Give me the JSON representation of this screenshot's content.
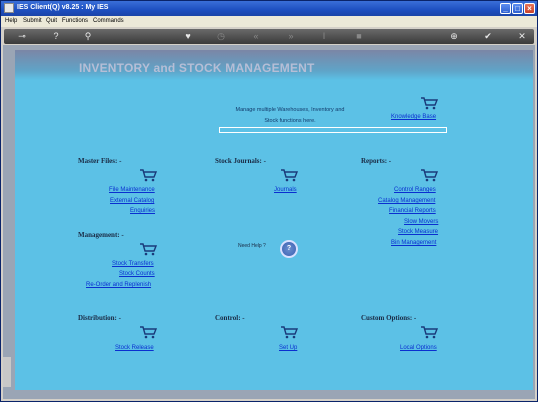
{
  "window": {
    "title": "IES Client(Q) v8.25 : My IES"
  },
  "menu": [
    "Help",
    "Submit",
    "Quit",
    "Functions",
    "Commands"
  ],
  "toolbar_icons": [
    "key-icon",
    "help-icon",
    "search-icon",
    "heart-icon",
    "clock-icon",
    "rewind-icon",
    "fast-forward-icon",
    "text-cursor-icon",
    "stop-icon",
    "add-icon",
    "check-icon",
    "close-icon"
  ],
  "page": {
    "title": "INVENTORY and STOCK MANAGEMENT",
    "intro_line1": "Manage multiple Warehouses, Inventory and",
    "intro_line2": "Stock functions here.",
    "knowledge_base": "Knowledge Base",
    "need_help": "Need Help ?",
    "help_symbol": "?"
  },
  "sections": {
    "master_files": {
      "title": "Master Files: -",
      "links": [
        "File Maintenance",
        "External Catalog",
        "Enquiries"
      ]
    },
    "stock_journals": {
      "title": "Stock Journals: -",
      "links": [
        "Journals"
      ]
    },
    "reports": {
      "title": "Reports: -",
      "links": [
        "Control Ranges",
        "Catalog Management",
        "Financial Reports",
        "Slow Movers",
        "Stock Measure",
        "Bin Management"
      ]
    },
    "management": {
      "title": "Management: -",
      "links": [
        "Stock Transfers",
        "Stock Counts",
        "Re-Order and Replenish"
      ]
    },
    "distribution": {
      "title": "Distribution: -",
      "links": [
        "Stock Release"
      ]
    },
    "control": {
      "title": "Control: -",
      "links": [
        "Set Up"
      ]
    },
    "custom_options": {
      "title": "Custom Options: -",
      "links": [
        "Local Options"
      ]
    }
  },
  "colors": {
    "panel": "#5cc1e6",
    "link": "#0a2fd0",
    "banner_text": "#b6bed6"
  }
}
